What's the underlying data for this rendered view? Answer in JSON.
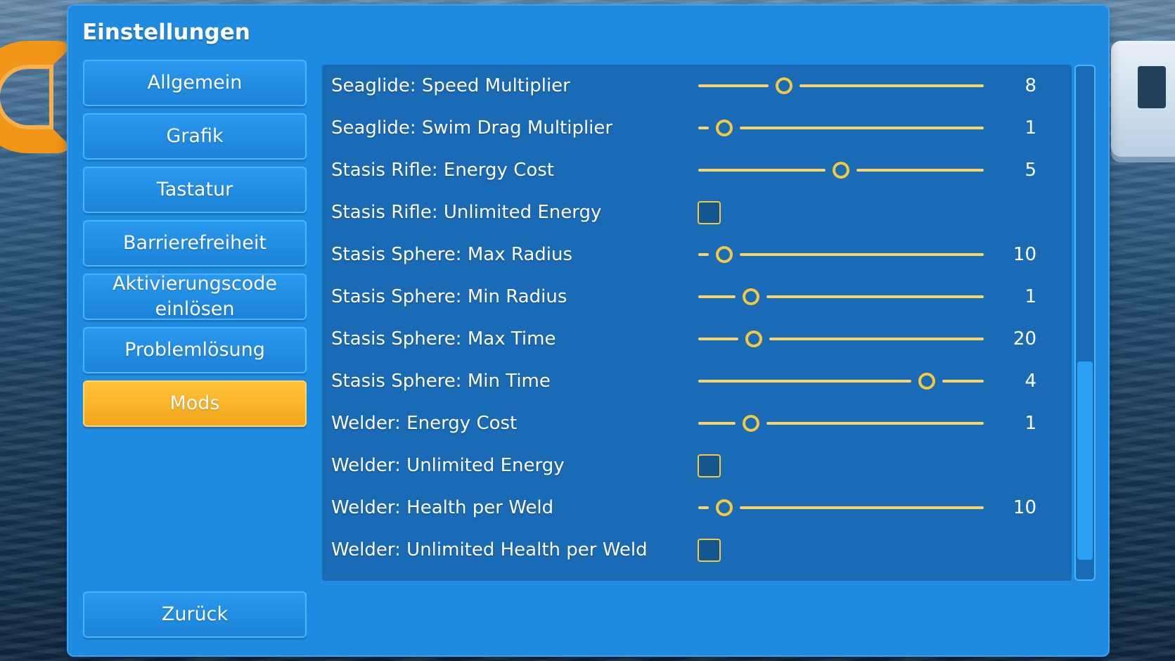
{
  "title": "Einstellungen",
  "nav": [
    {
      "label": "Allgemein",
      "active": false
    },
    {
      "label": "Grafik",
      "active": false
    },
    {
      "label": "Tastatur",
      "active": false
    },
    {
      "label": "Barrierefreiheit",
      "active": false
    },
    {
      "label": "Aktivierungscode einlösen",
      "active": false
    },
    {
      "label": "Problemlösung",
      "active": false
    },
    {
      "label": "Mods",
      "active": true
    }
  ],
  "back_label": "Zurück",
  "settings": [
    {
      "type": "slider",
      "label": "Seaglide: Speed Multiplier",
      "value": "8",
      "position": 0.3
    },
    {
      "type": "slider",
      "label": "Seaglide: Swim Drag Multiplier",
      "value": "1",
      "position": 0.09
    },
    {
      "type": "slider",
      "label": "Stasis Rifle: Energy Cost",
      "value": "5",
      "position": 0.5
    },
    {
      "type": "checkbox",
      "label": "Stasis Rifle: Unlimited Energy",
      "checked": false
    },
    {
      "type": "slider",
      "label": "Stasis Sphere: Max Radius",
      "value": "10",
      "position": 0.09
    },
    {
      "type": "slider",
      "label": "Stasis Sphere: Min Radius",
      "value": "1",
      "position": 0.185
    },
    {
      "type": "slider",
      "label": "Stasis Sphere: Max Time",
      "value": "20",
      "position": 0.195
    },
    {
      "type": "slider",
      "label": "Stasis Sphere: Min Time",
      "value": "4",
      "position": 0.8
    },
    {
      "type": "slider",
      "label": "Welder: Energy Cost",
      "value": "1",
      "position": 0.185
    },
    {
      "type": "checkbox",
      "label": "Welder: Unlimited Energy",
      "checked": false
    },
    {
      "type": "slider",
      "label": "Welder: Health per Weld",
      "value": "10",
      "position": 0.09
    },
    {
      "type": "checkbox",
      "label": "Welder: Unlimited Health per Weld",
      "checked": false
    }
  ],
  "colors": {
    "panel": "#1f8be0",
    "content": "#1a6bb6",
    "accent": "#f5c842",
    "active_tab": "#f4a51c"
  },
  "scroll_position": 0.6
}
